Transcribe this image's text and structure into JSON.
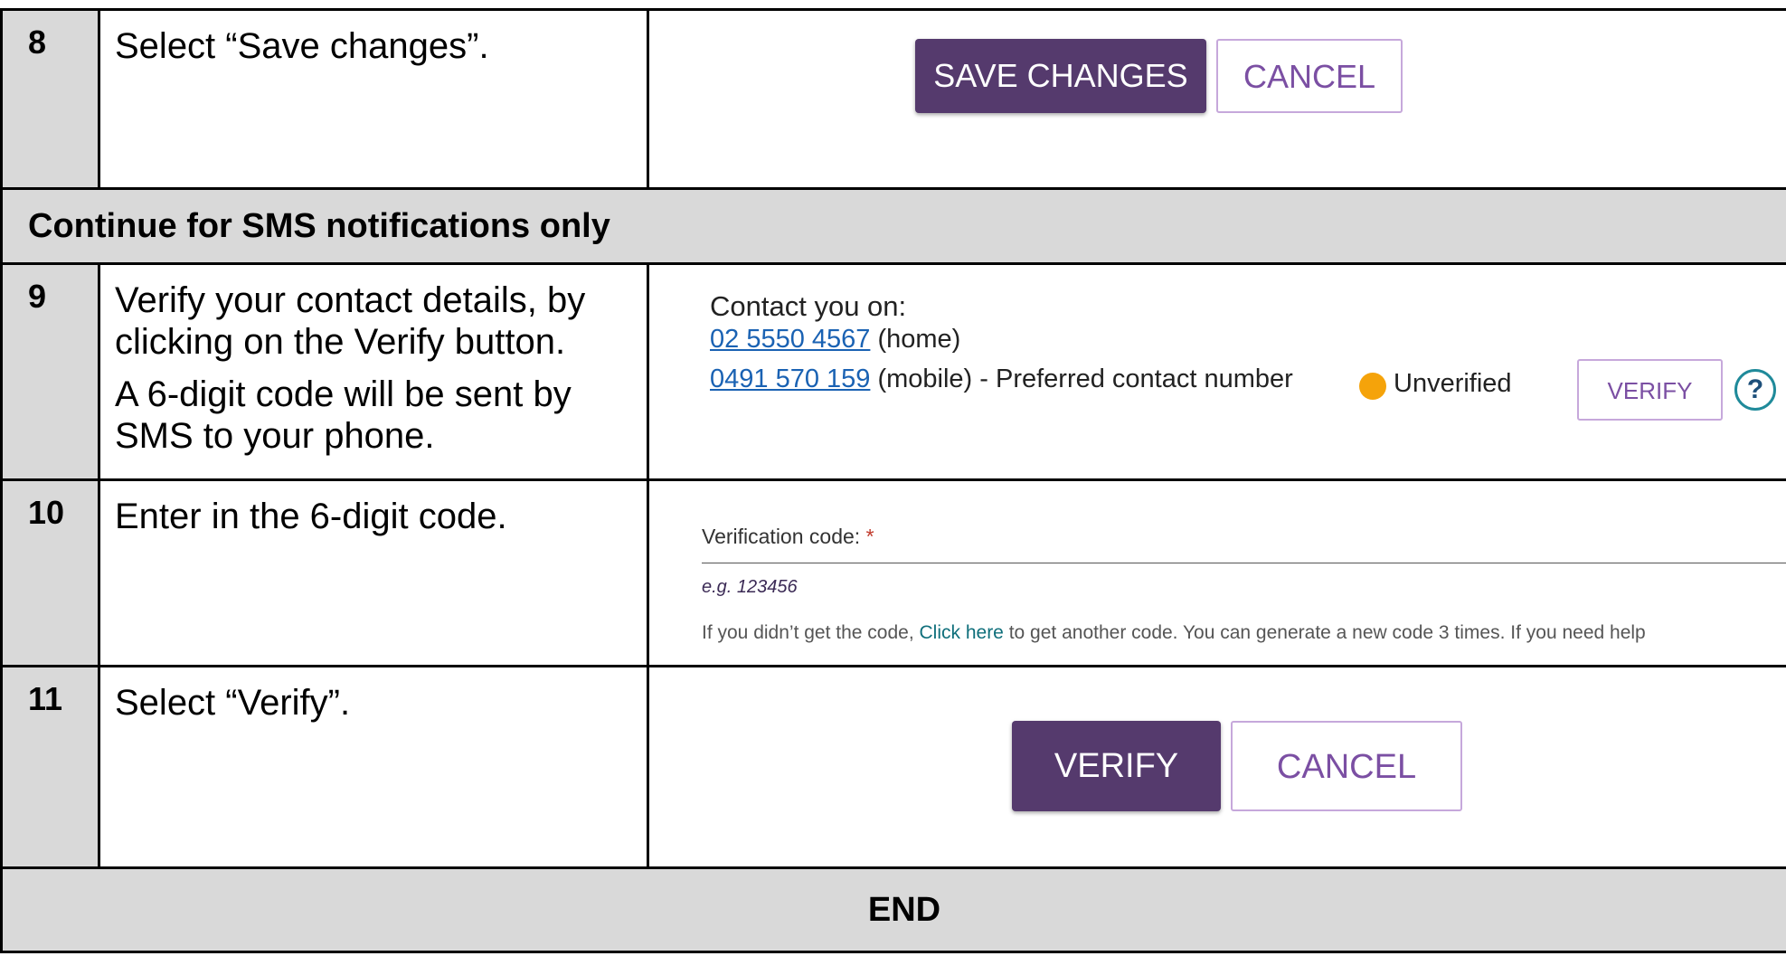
{
  "rows": {
    "step8": {
      "number": "8",
      "instruction": "Select “Save changes”.",
      "save_label": "SAVE CHANGES",
      "cancel_label": "CANCEL"
    },
    "sms_band": {
      "text": "Continue for SMS notifications only"
    },
    "step9": {
      "number": "9",
      "instruction_1": "Verify your contact details, by clicking on the Verify button.",
      "instruction_2": "A 6-digit code will be sent by SMS to your phone.",
      "contact_title": "Contact you on:",
      "home_number": "02 5550 4567",
      "home_suffix": " (home)",
      "mobile_number": "0491 570 159",
      "mobile_suffix": " (mobile) - Preferred contact number",
      "status": "Unverified",
      "verify_label": "VERIFY",
      "help_glyph": "?"
    },
    "step10": {
      "number": "10",
      "instruction": "Enter in the 6-digit code.",
      "field_label": "Verification code: ",
      "required_mark": "*",
      "hint": "e.g. 123456",
      "help_prefix": "If you didn’t get the code, ",
      "help_link": "Click here",
      "help_suffix": " to get another code. You can generate a new code 3 times. If you need help"
    },
    "step11": {
      "number": "11",
      "instruction": "Select “Verify”.",
      "verify_label": "VERIFY",
      "cancel_label": "CANCEL"
    },
    "end": {
      "text": "END"
    }
  },
  "colors": {
    "band_gray": "#d9d9d9",
    "primary_purple": "#553a6d",
    "secondary_text_purple": "#7b4fa3",
    "secondary_border": "#c6a8db",
    "link_blue": "#1a62b3",
    "status_orange": "#f5a30a",
    "help_teal": "#1f8a9a"
  }
}
